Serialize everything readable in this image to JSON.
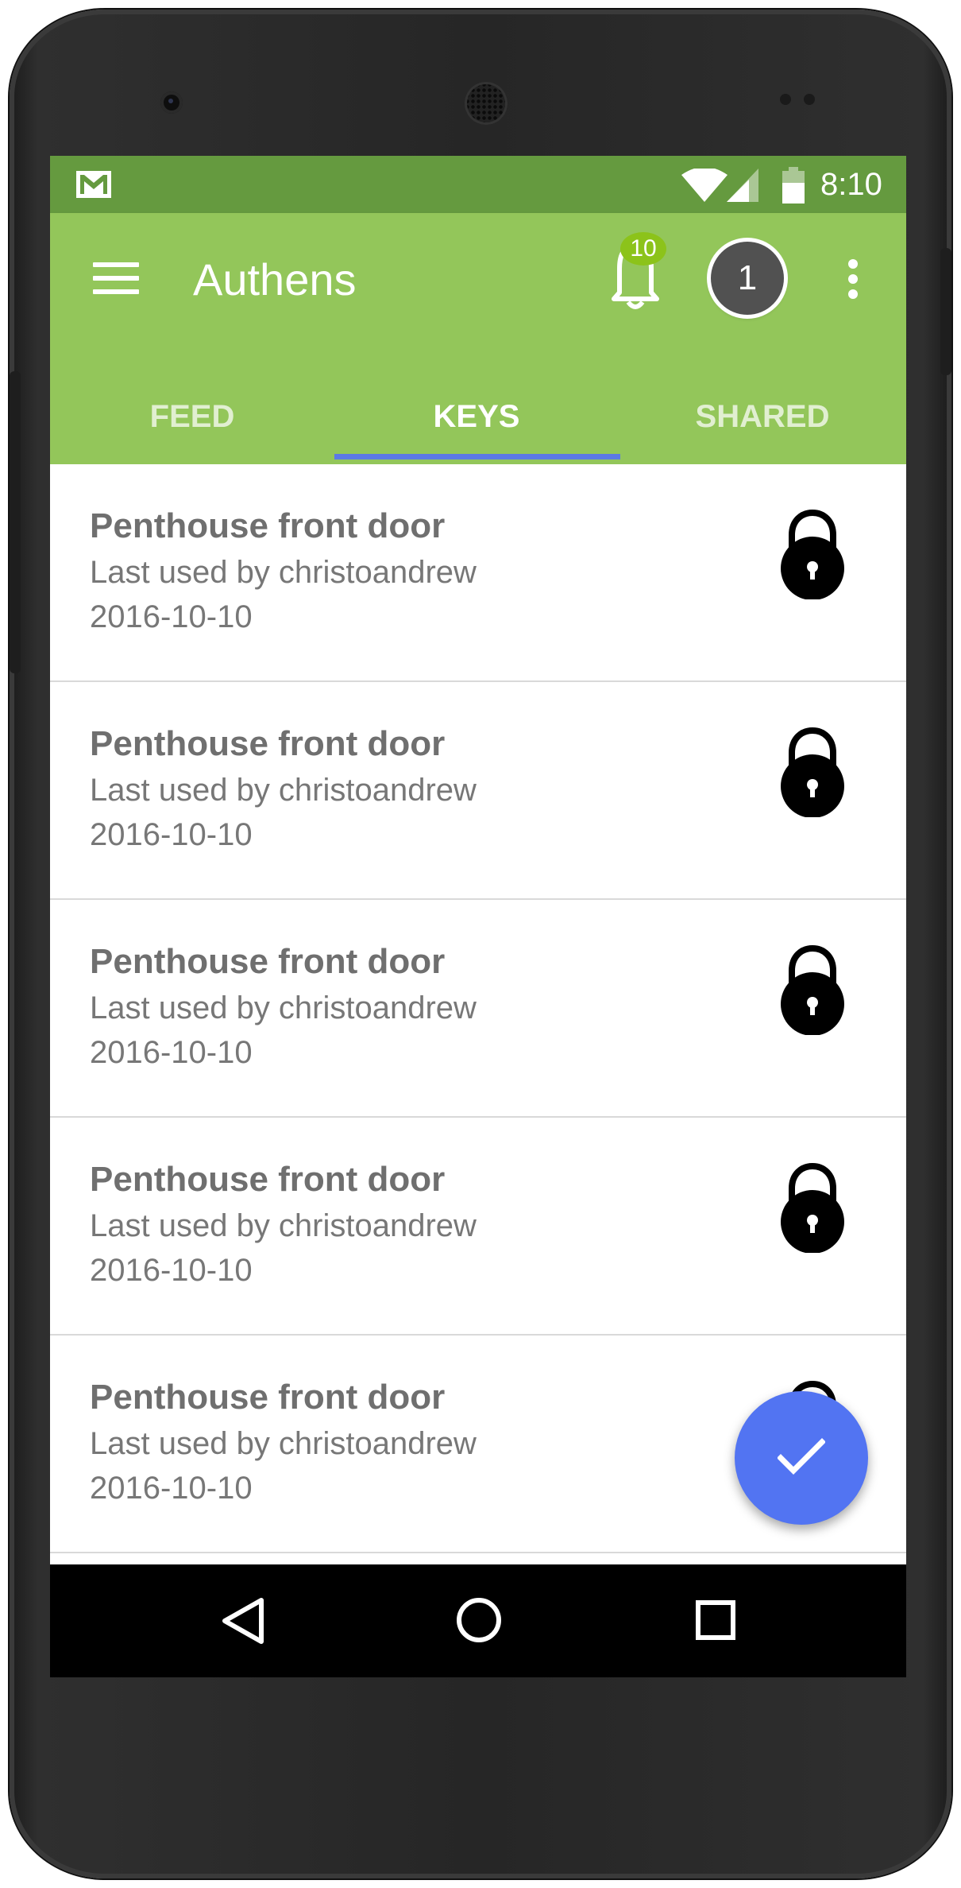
{
  "status_bar": {
    "time": "8:10",
    "icons": [
      "gmail-icon",
      "wifi-icon",
      "signal-icon",
      "battery-icon"
    ]
  },
  "app_bar": {
    "title": "Authens",
    "notification_count": "10",
    "account_badge": "1",
    "icons": [
      "menu-icon",
      "bell-icon",
      "overflow-icon"
    ]
  },
  "tabs": [
    {
      "label": "FEED",
      "active": false
    },
    {
      "label": "KEYS",
      "active": true
    },
    {
      "label": "SHARED",
      "active": false
    }
  ],
  "keys": [
    {
      "title": "Penthouse front door",
      "subtitle": "Last used by christoandrew",
      "date": "2016-10-10",
      "icon": "lock-icon"
    },
    {
      "title": "Penthouse front door",
      "subtitle": "Last used by christoandrew",
      "date": "2016-10-10",
      "icon": "lock-icon"
    },
    {
      "title": "Penthouse front door",
      "subtitle": "Last used by christoandrew",
      "date": "2016-10-10",
      "icon": "lock-icon"
    },
    {
      "title": "Penthouse front door",
      "subtitle": "Last used by christoandrew",
      "date": "2016-10-10",
      "icon": "lock-icon"
    },
    {
      "title": "Penthouse front door",
      "subtitle": "Last used by christoandrew",
      "date": "2016-10-10",
      "icon": "lock-icon"
    }
  ],
  "fab": {
    "icon": "check-icon"
  },
  "nav_bar": {
    "icons": [
      "back-icon",
      "home-icon",
      "recents-icon"
    ]
  },
  "colors": {
    "status_bar": "#659a3f",
    "app_bar": "#93c65a",
    "tab_indicator": "#5b79e6",
    "fab": "#5274f2",
    "badge": "#8cc31a"
  }
}
